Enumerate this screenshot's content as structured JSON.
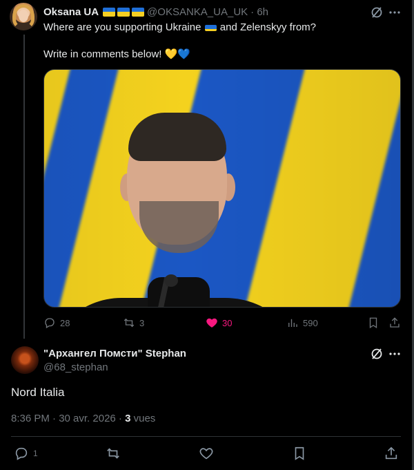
{
  "colors": {
    "background": "#000000",
    "text": "#e7e9ea",
    "muted": "#71767b",
    "like_pink": "#f91880",
    "divider": "#2f3336",
    "flag_blue": "#1f6fd8",
    "flag_yellow": "#f5cf22"
  },
  "post": {
    "author_name": "Oksana UA",
    "handle": "@OKSANKA_UA_UK",
    "time": "· 6h",
    "text_line1_a": "Where are you supporting Ukraine",
    "text_line1_b": "and Zelenskyy from?",
    "text_line2": "Write in comments below!",
    "emoji_hearts": [
      "💛",
      "💙"
    ],
    "image_icon": "photo-zelenskyy-flag-background",
    "actions": {
      "replies": "28",
      "reposts": "3",
      "likes": "30",
      "views": "590",
      "liked": true
    }
  },
  "reply": {
    "author_name": "\"Архангел Помсти\" Stephan",
    "handle": "@68_stephan",
    "text": "Nord Italia",
    "timestamp": "8:36 PM · 30 avr. 2026 · ",
    "views_count": "3",
    "views_label": " vues",
    "actions": {
      "replies": "1"
    }
  },
  "icons": {
    "grok": "grok-icon",
    "more": "more-horizontal-icon",
    "reply": "reply-bubble-icon",
    "repost": "repost-icon",
    "like": "heart-icon",
    "views": "views-bars-icon",
    "bookmark": "bookmark-icon",
    "share": "share-icon"
  }
}
